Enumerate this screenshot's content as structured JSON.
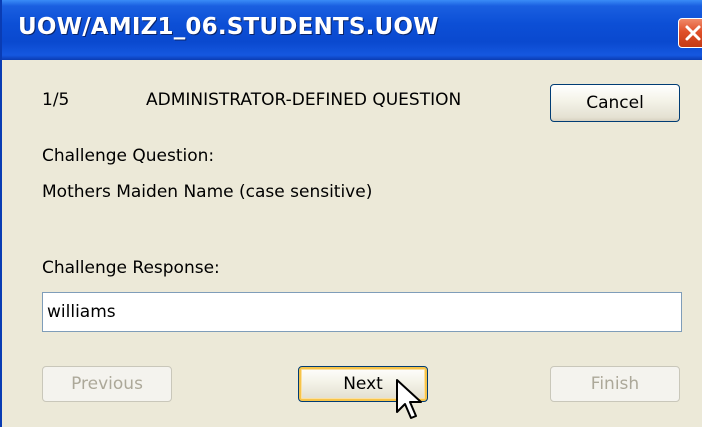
{
  "window": {
    "title": "UOW/AMIZ1_06.STUDENTS.UOW"
  },
  "icons": {
    "close": "close-icon",
    "cursor": "mouse-pointer-icon"
  },
  "colors": {
    "titlebar": "#0a49cf",
    "close_button": "#e0502a",
    "dialog_background": "#ece9d8",
    "default_button_highlight": "#f6c44a"
  },
  "header": {
    "step": "1/5",
    "heading": "ADMINISTRATOR-DEFINED QUESTION"
  },
  "question": {
    "label": "Challenge Question:",
    "text": "Mothers Maiden Name (case sensitive)"
  },
  "response": {
    "label": "Challenge Response:",
    "value": "williams"
  },
  "buttons": {
    "cancel": "Cancel",
    "previous": "Previous",
    "next": "Next",
    "finish": "Finish"
  }
}
